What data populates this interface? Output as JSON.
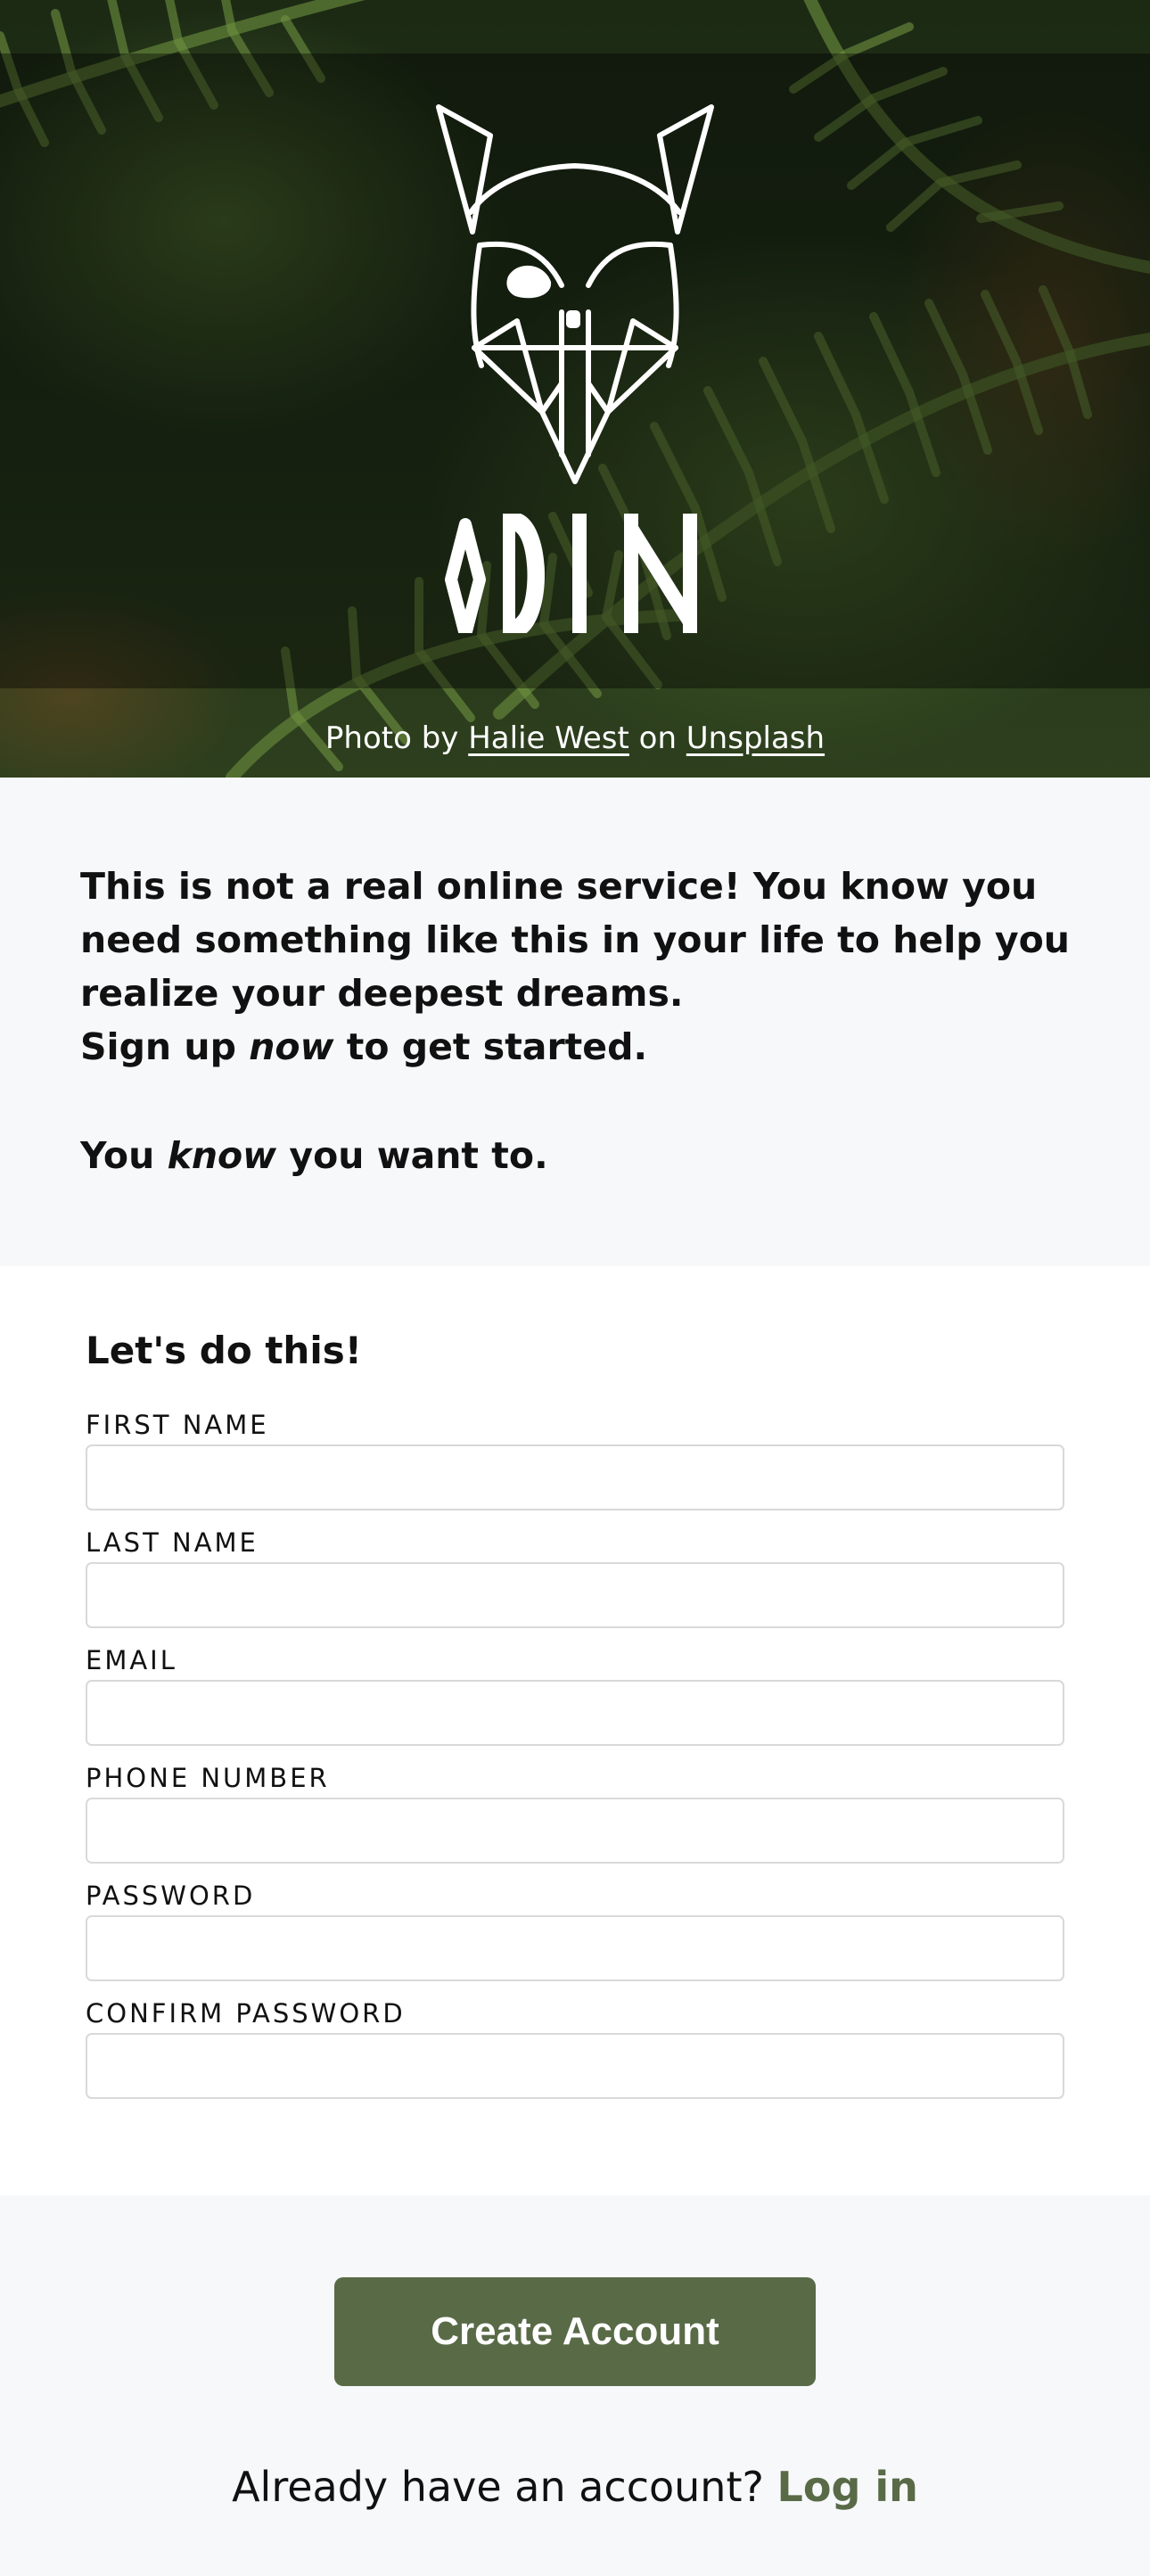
{
  "hero": {
    "brand": "ODIN",
    "credit_prefix": "Photo by ",
    "credit_author": "Halie West",
    "credit_middle": " on ",
    "credit_source": "Unsplash"
  },
  "intro": {
    "line1": "This is not a real online service! You know you need something like this in your life to help you realize your deepest dreams.",
    "line2_before": "Sign up ",
    "line2_em": "now",
    "line2_after": " to get started.",
    "line3_before": "You ",
    "line3_em": "know",
    "line3_after": " you want to."
  },
  "form": {
    "heading": "Let's do this!",
    "fields": [
      {
        "label": "FIRST NAME",
        "value": ""
      },
      {
        "label": "LAST NAME",
        "value": ""
      },
      {
        "label": "EMAIL",
        "value": ""
      },
      {
        "label": "PHONE NUMBER",
        "value": ""
      },
      {
        "label": "PASSWORD",
        "value": ""
      },
      {
        "label": "CONFIRM PASSWORD",
        "value": ""
      }
    ]
  },
  "actions": {
    "create_label": "Create Account",
    "login_prompt": "Already have an account? ",
    "login_link": "Log in"
  },
  "colors": {
    "accent": "#596a47",
    "page_bg": "#f7f8fa",
    "card_bg": "#ffffff"
  }
}
